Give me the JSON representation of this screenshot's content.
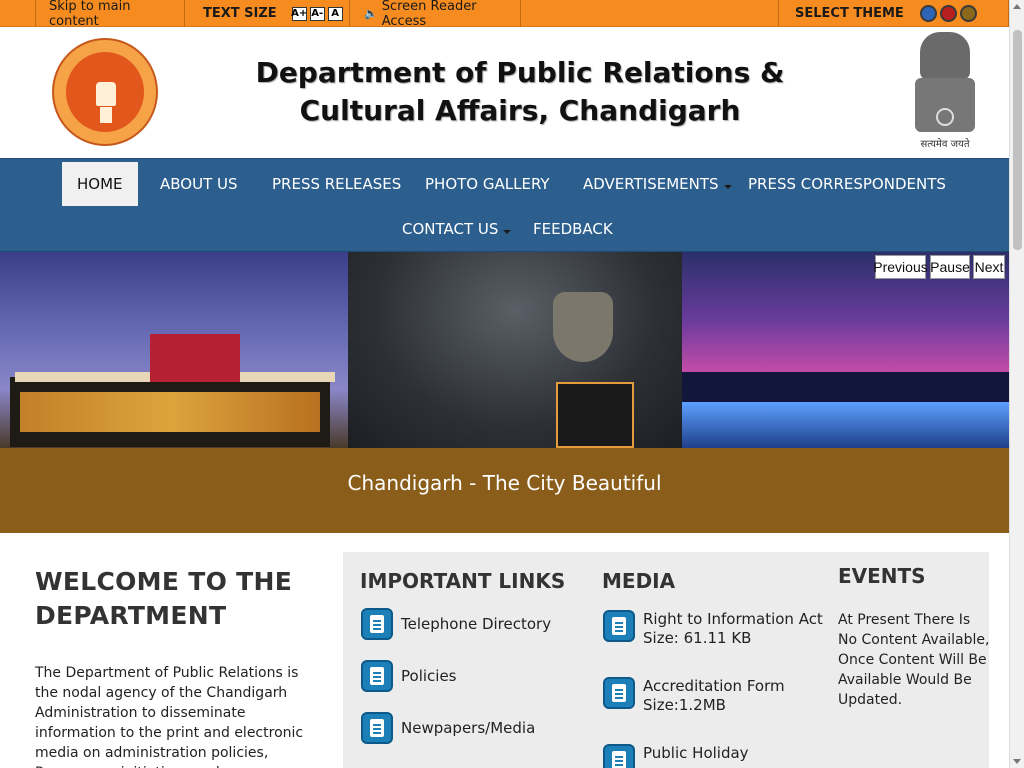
{
  "topbar": {
    "skip_label": "Skip to main content",
    "text_size_label": "TEXT SIZE",
    "text_size_buttons": [
      "A+",
      "A-",
      "A"
    ],
    "screen_reader_label": "Screen Reader Access",
    "select_theme_label": "SELECT THEME",
    "theme_colors": [
      "#2e64b8",
      "#b81f1f",
      "#8a6a1a"
    ]
  },
  "header": {
    "title": "Department of Public Relations & Cultural Affairs, Chandigarh",
    "emblem_motto": "सत्यमेव जयते"
  },
  "nav": {
    "items": [
      {
        "label": "HOME",
        "active": true
      },
      {
        "label": "ABOUT US"
      },
      {
        "label": "PRESS RELEASES"
      },
      {
        "label": "PHOTO GALLERY"
      },
      {
        "label": "ADVERTISEMENTS",
        "dropdown": true
      },
      {
        "label": "PRESS CORRESPONDENTS"
      },
      {
        "label": "CONTACT US",
        "dropdown": true
      },
      {
        "label": "FEEDBACK"
      }
    ]
  },
  "slider": {
    "caption": "Chandigarh - The City Beautiful",
    "prev_label": "Previous",
    "pause_label": "Pause",
    "next_label": "Next"
  },
  "welcome": {
    "heading": "WELCOME TO THE DEPARTMENT",
    "body": "The Department of Public Relations is the nodal agency of the Chandigarh Administration to disseminate information to the print and electronic media on administration policies, Programme initiatives and achievements..."
  },
  "important_links": {
    "title": "IMPORTANT LINKS",
    "items": [
      "Telephone Directory",
      "Policies",
      "Newpapers/Media"
    ]
  },
  "media": {
    "title": "MEDIA",
    "items": [
      {
        "title": "Right to Information Act",
        "size": "Size: 61.11 KB"
      },
      {
        "title": "Accreditation Form",
        "size": "Size:1.2MB"
      },
      {
        "title": "Public Holiday",
        "size": ""
      }
    ]
  },
  "events": {
    "title": "EVENTS",
    "text": "At Present There Is No Content Available, Once Content Will Be Available Would Be Updated."
  }
}
